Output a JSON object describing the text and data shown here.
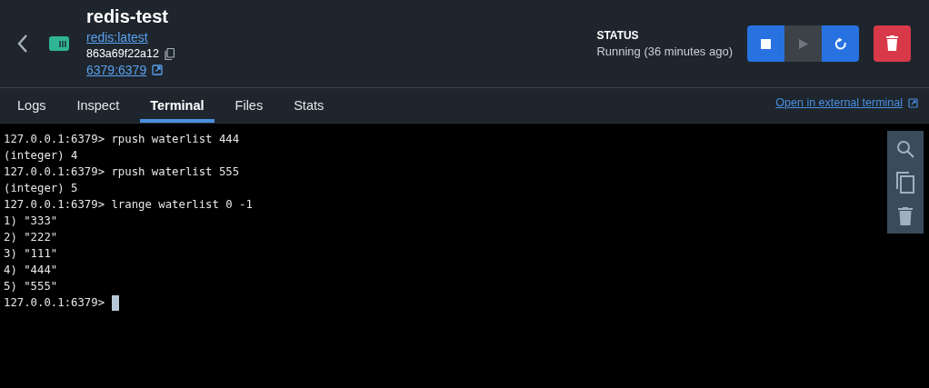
{
  "container": {
    "name": "redis-test",
    "image": "redis:latest",
    "id": "863a69f22a12",
    "ports": "6379:6379"
  },
  "status": {
    "label": "STATUS",
    "text": "Running (36 minutes ago)"
  },
  "actions": [
    {
      "kind": "stop",
      "disabled": false
    },
    {
      "kind": "start",
      "disabled": true
    },
    {
      "kind": "restart",
      "disabled": false
    },
    {
      "kind": "delete",
      "disabled": false
    }
  ],
  "tabs": [
    {
      "label": "Logs",
      "selected": false
    },
    {
      "label": "Inspect",
      "selected": false
    },
    {
      "label": "Terminal",
      "selected": true
    },
    {
      "label": "Files",
      "selected": false
    },
    {
      "label": "Stats",
      "selected": false
    }
  ],
  "external_link": "Open in external terminal",
  "terminal": {
    "lines": [
      {
        "kind": "text",
        "text": "127.0.0.1:6379> rpush waterlist 444"
      },
      {
        "kind": "text",
        "text": "(integer) 4"
      },
      {
        "kind": "text",
        "text": "127.0.0.1:6379> rpush waterlist 555"
      },
      {
        "kind": "text",
        "text": "(integer) 5"
      },
      {
        "kind": "text",
        "text": "127.0.0.1:6379> lrange waterlist 0 -1"
      },
      {
        "kind": "text",
        "text": "1) \"333\""
      },
      {
        "kind": "text",
        "text": "2) \"222\""
      },
      {
        "kind": "text",
        "text": "3) \"111\""
      },
      {
        "kind": "text",
        "text": "4) \"444\""
      },
      {
        "kind": "text",
        "text": "5) \"555\""
      },
      {
        "kind": "prompt",
        "text": "127.0.0.1:6379>"
      }
    ]
  }
}
